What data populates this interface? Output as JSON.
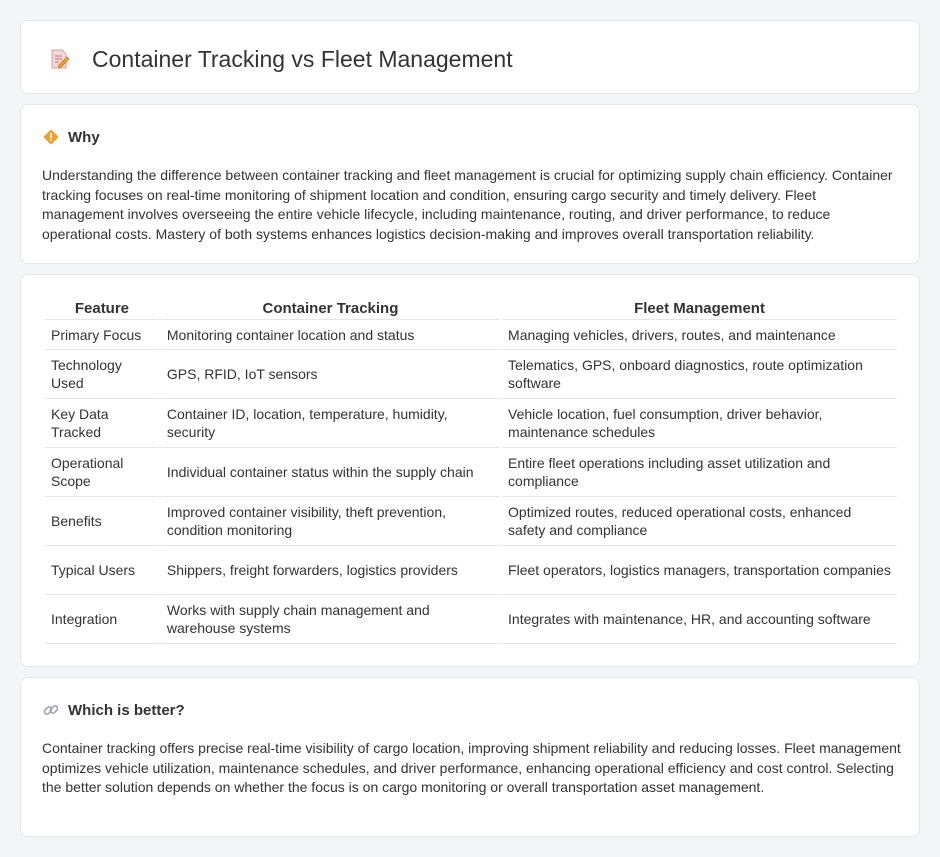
{
  "header": {
    "title": "Container Tracking vs Fleet Management",
    "icon": "edit-document-icon"
  },
  "why": {
    "title": "Why",
    "icon": "diamond-signal-icon",
    "body": "Understanding the difference between container tracking and fleet management is crucial for optimizing supply chain efficiency. Container tracking focuses on real-time monitoring of shipment location and condition, ensuring cargo security and timely delivery. Fleet management involves overseeing the entire vehicle lifecycle, including maintenance, routing, and driver performance, to reduce operational costs. Mastery of both systems enhances logistics decision-making and improves overall transportation reliability."
  },
  "table": {
    "headers": [
      "Feature",
      "Container Tracking",
      "Fleet Management"
    ],
    "rows": [
      [
        "Primary Focus",
        "Monitoring container location and status",
        "Managing vehicles, drivers, routes, and maintenance"
      ],
      [
        "Technology Used",
        "GPS, RFID, IoT sensors",
        "Telematics, GPS, onboard diagnostics, route optimization software"
      ],
      [
        "Key Data Tracked",
        "Container ID, location, temperature, humidity, security",
        "Vehicle location, fuel consumption, driver behavior, maintenance schedules"
      ],
      [
        "Operational Scope",
        "Individual container status within the supply chain",
        "Entire fleet operations including asset utilization and compliance"
      ],
      [
        "Benefits",
        "Improved container visibility, theft prevention, condition monitoring",
        "Optimized routes, reduced operational costs, enhanced safety and compliance"
      ],
      [
        "Typical Users",
        "Shippers, freight forwarders, logistics providers",
        "Fleet operators, logistics managers, transportation companies"
      ],
      [
        "Integration",
        "Works with supply chain management and warehouse systems",
        "Integrates with maintenance, HR, and accounting software"
      ]
    ]
  },
  "better": {
    "title": "Which is better?",
    "icon": "link-icon",
    "body": "Container tracking offers precise real-time visibility of cargo location, improving shipment reliability and reducing losses. Fleet management optimizes vehicle utilization, maintenance schedules, and driver performance, enhancing operational efficiency and cost control. Selecting the better solution depends on whether the focus is on cargo monitoring or overall transportation asset management."
  },
  "colors": {
    "background": "#f4f5f7",
    "card": "#ffffff",
    "border": "#e3e5e8",
    "text": "#333333",
    "accent_orange": "#f0a030"
  }
}
